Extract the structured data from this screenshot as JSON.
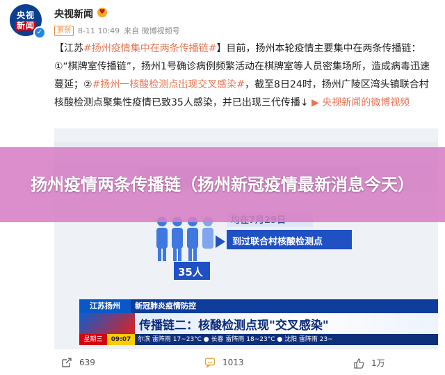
{
  "header": {
    "avatar_line1": "央视",
    "avatar_line2": "新闻",
    "username": "央视新闻",
    "original_tag": "原创",
    "timestamp": "8-11 10:49",
    "source": "来自 微博视频号"
  },
  "post": {
    "bracket_open": "【江苏",
    "hashtag1": "#扬州疫情集中在两条传播链#",
    "bracket_close": "】",
    "text1": "目前，扬州本轮疫情主要集中在两条传播链：①“棋牌室传播链”，扬州1号确诊病例频繁活动在棋牌室等人员密集场所，造成病毒迅速蔓延；②",
    "hashtag2": "#扬州一核酸检测点出现交叉感染#",
    "text2": "，截至8日24时，扬州广陵区湾头镇联合村核酸检测点聚集性疫情已致35人感染，并已出现三代传播↓ ",
    "video_link": "央视新闻的微博视频"
  },
  "image": {
    "date_label": "均在7月29日",
    "place_label": "到过联合村核酸检测点",
    "count_label": "35人",
    "tv_region": "江苏扬州",
    "tv_topic": "新冠肺炎疫情防控",
    "tv_headline": "传播链二：核酸检测点现\"交叉感染\"",
    "tv_day": "星期三",
    "tv_time": "09:07",
    "tv_weather": "尔滨 雷阵雨 17~23°C  ● 长春 雷阵雨 18~23°C  ● 沈阳 雷阵雨 23~"
  },
  "overlay": {
    "title": "扬州疫情两条传播链（扬州新冠疫情最新消息今天）"
  },
  "footer": {
    "share_count": "639",
    "comment_count": "1013",
    "like_count": "1万"
  },
  "colors": {
    "accent": "#eb7350",
    "overlay": "#d67ec4",
    "tv_blue": "#0f3d9c"
  }
}
